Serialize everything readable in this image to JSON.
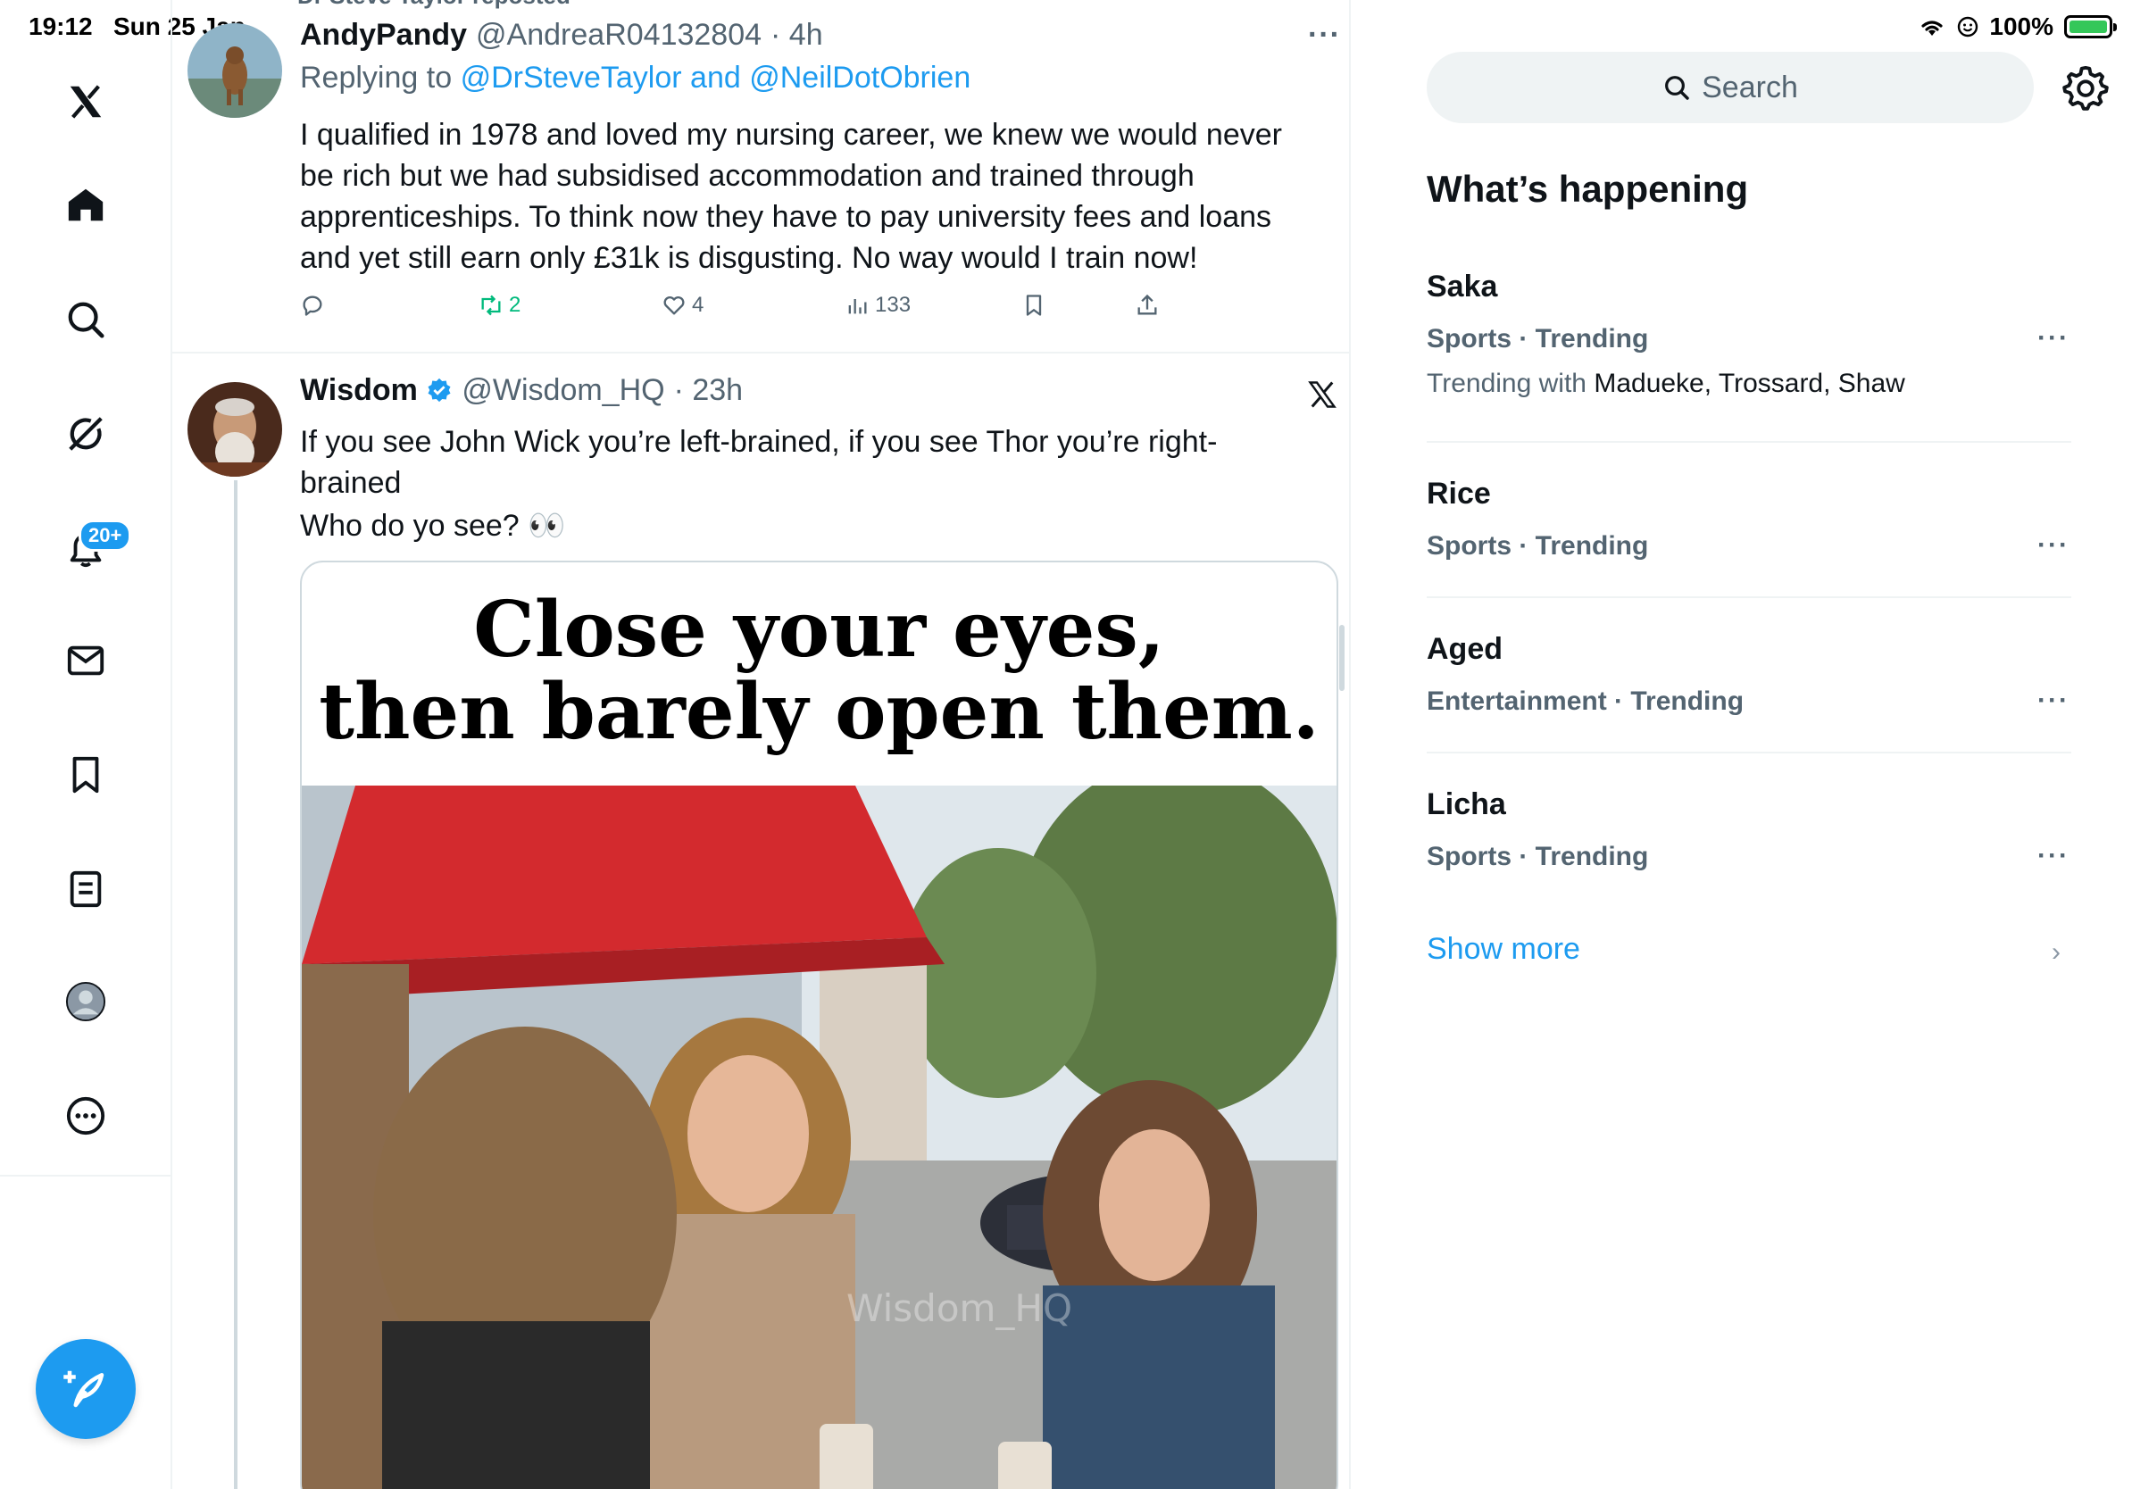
{
  "status_bar": {
    "time": "19:12",
    "date": "Sun 25 Jan",
    "battery": "100%",
    "battery_level": 1.0,
    "icons": [
      "wifi-icon",
      "focus-icon",
      "battery-charging-icon"
    ]
  },
  "nav": {
    "logo": "x-logo-icon",
    "items": [
      {
        "name": "home",
        "icon": "home-icon"
      },
      {
        "name": "explore",
        "icon": "search-icon"
      },
      {
        "name": "grok",
        "icon": "grok-icon"
      },
      {
        "name": "notifications",
        "icon": "bell-icon",
        "badge": "20+"
      },
      {
        "name": "messages",
        "icon": "envelope-icon"
      },
      {
        "name": "bookmarks",
        "icon": "bookmark-icon"
      },
      {
        "name": "lists",
        "icon": "list-icon"
      },
      {
        "name": "profile",
        "icon": "avatar-icon"
      },
      {
        "name": "more",
        "icon": "more-circle-icon"
      }
    ],
    "compose_icon": "compose-feather-icon"
  },
  "timeline": {
    "repost_context": "Dr Steve Taylor reposted",
    "tweet1": {
      "name": "AndyPandy",
      "handle": "@AndreaR04132804",
      "time": "· 4h",
      "replying_to_prefix": "Replying to",
      "replying_to_users": "@DrSteveTaylor and @NeilDotObrien",
      "text": "I qualified in 1978 and loved my nursing career, we knew we would never be rich but we had subsidised accommodation and trained through apprenticeships. To think now they have to pay university fees and loans and yet still earn only £31k is disgusting. No way would I train now!",
      "more": "···",
      "retweets": "2",
      "likes": "4",
      "views": "133"
    },
    "tweet2": {
      "name": "Wisdom",
      "handle": "@Wisdom_HQ",
      "time": "· 23h",
      "text_line1": "If you see John Wick you’re left-brained, if you see Thor you’re right-brained",
      "text_line2": "Who do yo see? 👀",
      "media_caption_line1": "Close your eyes,",
      "media_caption_line2": "then barely open them.",
      "media_watermark": "Wisdom_HQ"
    }
  },
  "sidebar": {
    "search_placeholder": "Search",
    "heading": "What’s happening",
    "trends": [
      {
        "title": "Saka",
        "meta": "Sports · Trending",
        "with_prefix": "Trending with",
        "with_names": "Madueke, Trossard, Shaw"
      },
      {
        "title": "Rice",
        "meta": "Sports · Trending"
      },
      {
        "title": "Aged",
        "meta": "Entertainment · Trending"
      },
      {
        "title": "Licha",
        "meta": "Sports · Trending"
      }
    ],
    "trend_more": "···",
    "show_more": "Show more"
  },
  "colors": {
    "accent": "#1d9bf0",
    "text": "#0f1419",
    "secondary": "#536471",
    "retweet_green": "#00ba7c",
    "border": "#eff3f4"
  }
}
